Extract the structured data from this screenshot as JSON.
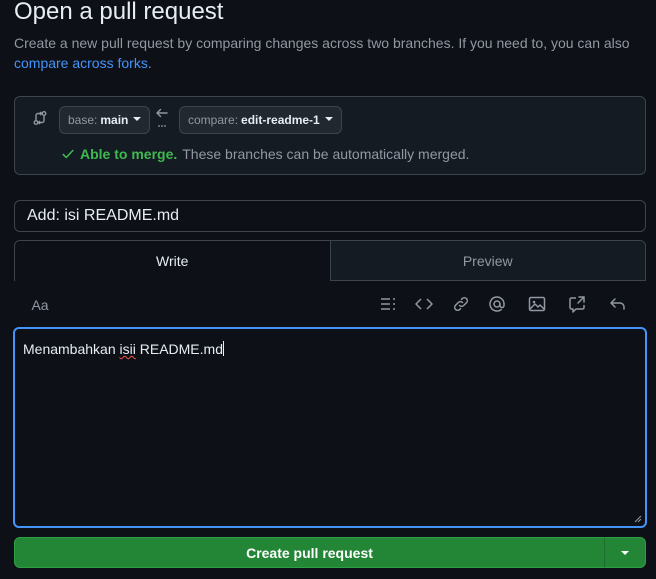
{
  "header": {
    "title": "Open a pull request",
    "subtitle_text": "Create a new pull request by comparing changes across two branches. If you need to, you can also",
    "subtitle_link": "compare across forks",
    "subtitle_end": "."
  },
  "compare": {
    "base_label": "base:",
    "base_value": "main",
    "compare_label": "compare:",
    "compare_value": "edit-readme-1",
    "merge_ok": "Able to merge.",
    "merge_text": "These branches can be automatically merged."
  },
  "form": {
    "title_value": "Add: isi README.md",
    "tab_write": "Write",
    "tab_preview": "Preview",
    "text_style_label": "Aa",
    "body_before": "Menambahkan ",
    "body_typo": "isii",
    "body_after": " README.md",
    "submit_label": "Create pull request"
  },
  "colors": {
    "accent": "#4493f8",
    "success": "#3fb950",
    "button": "#238636",
    "background": "#0d1117"
  },
  "icons": [
    "compare-icon",
    "arrow-left-icon",
    "check-icon",
    "heading-icon",
    "code-icon",
    "link-icon",
    "mention-icon",
    "image-icon",
    "cross-reference-icon",
    "undo-icon",
    "chevron-down-icon"
  ]
}
